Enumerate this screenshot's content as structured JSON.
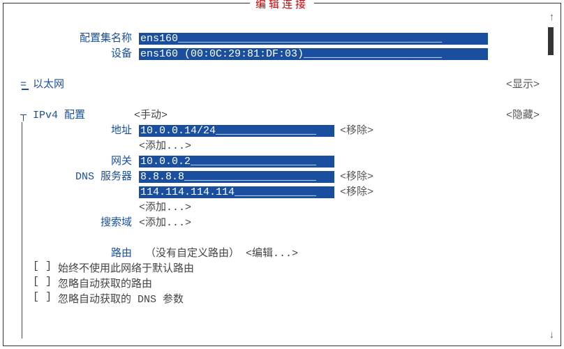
{
  "title": "编辑连接",
  "arrows": {
    "up": "↑",
    "down": "↓"
  },
  "profile": {
    "name_label": "配置集名称",
    "name_value": "ens160__________________________________________",
    "device_label": "设备",
    "device_value": "ens160 (00:0C:29:81:DF:03)______________________"
  },
  "ethernet": {
    "mark": "=",
    "label": "以太网",
    "toggle": "<显示>"
  },
  "ipv4": {
    "mark": "┬",
    "label": "IPv4 配置",
    "mode": "<手动>",
    "toggle": "<隐藏>",
    "address_label": "地址",
    "address_value": "10.0.0.14/24________________",
    "remove": "<移除>",
    "add": "<添加...>",
    "gateway_label": "网关",
    "gateway_value": "10.0.0.2____________________",
    "dns_label": "DNS 服务器",
    "dns1": "8.8.8.8_____________________",
    "dns2": "114.114.114.114_____________",
    "search_label": "搜索域",
    "route_label": "路由",
    "route_text": " （没有自定义路由） ",
    "route_edit": "<编辑...>"
  },
  "checkboxes": {
    "cb": "[ ]",
    "c1": "始终不使用此网络于默认路由",
    "c2": "忽略自动获取的路由",
    "c3": "忽略自动获取的 DNS 参数"
  }
}
